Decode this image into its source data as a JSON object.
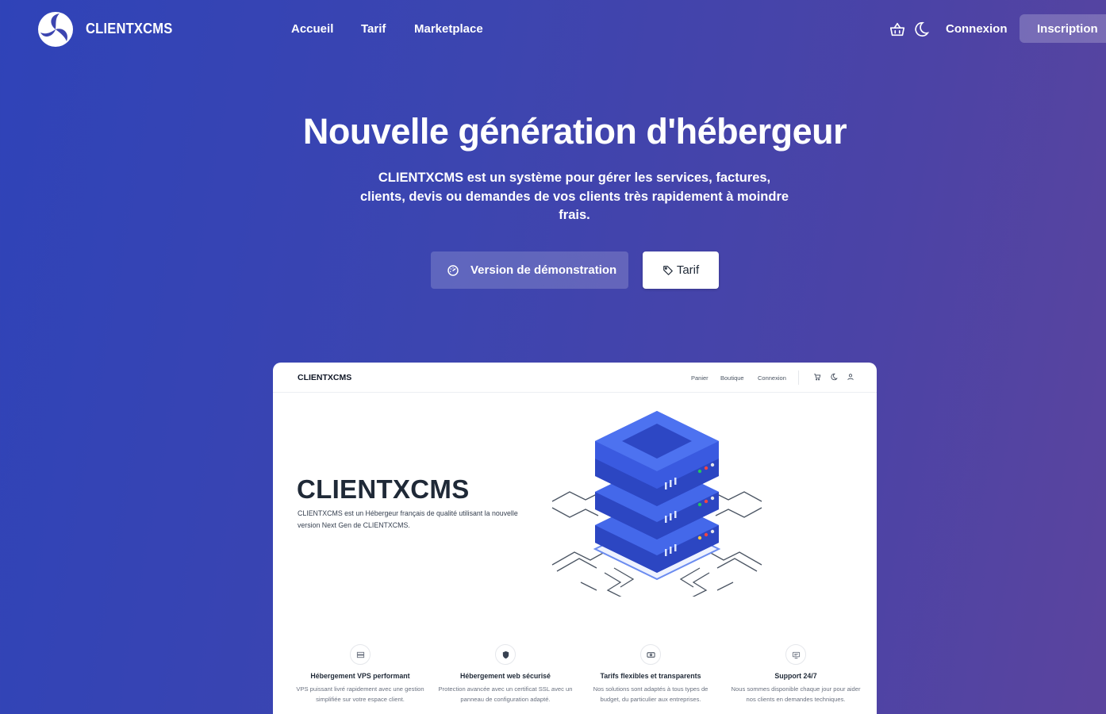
{
  "nav": {
    "brand": "CLIENTXCMS",
    "links": [
      "Accueil",
      "Tarif",
      "Marketplace"
    ],
    "basket_icon": "basket-icon",
    "theme_icon": "moon-icon",
    "login": "Connexion",
    "signup": "Inscription"
  },
  "hero": {
    "title": "Nouvelle génération d'hébergeur",
    "description": "CLIENTXCMS est un système pour gérer les services, factures, clients, devis ou demandes de vos clients très rapidement à moindre frais.",
    "demo_button": "Version de démonstration",
    "demo_icon": "gauge-icon",
    "tarif_button": "Tarif",
    "tarif_icon": "tag-icon"
  },
  "preview": {
    "brand": "CLIENTXCMS",
    "links": [
      "Panier",
      "Boutique",
      "Connexion"
    ],
    "icons": [
      "cart-icon",
      "moon-icon",
      "user-icon"
    ],
    "title": "CLIENTXCMS",
    "description": "CLIENTXCMS est un Hébergeur français de qualité utilisant la nouvelle version Next Gen de CLIENTXCMS.",
    "features": [
      {
        "icon": "server-icon",
        "title": "Hébergement VPS performant",
        "text": "VPS puissant livré rapidement avec une gestion simplifiée sur votre espace client."
      },
      {
        "icon": "shield-icon",
        "title": "Hébergement web sécurisé",
        "text": "Protection avancée avec un certificat SSL avec un panneau de configuration adapté."
      },
      {
        "icon": "money-icon",
        "title": "Tarifs flexibles et transparents",
        "text": "Nos solutions sont adaptés à tous types de budget, du particulier aux entreprises."
      },
      {
        "icon": "support-icon",
        "title": "Support 24/7",
        "text": "Nous sommes disponible chaque jour pour aider nos clients en demandes techniques."
      }
    ]
  },
  "colors": {
    "accent": "#3c45b0",
    "server_blue": "#3b5fe0",
    "text_dark": "#1f2937"
  }
}
